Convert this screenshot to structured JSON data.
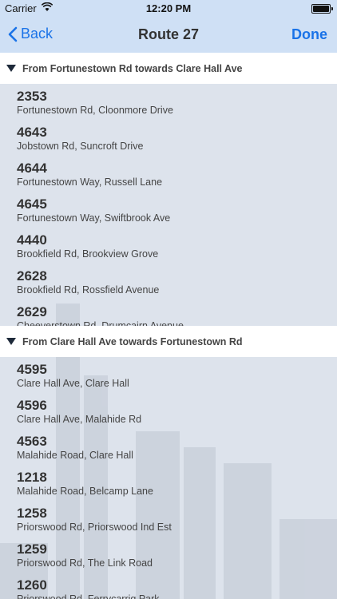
{
  "status_bar": {
    "carrier": "Carrier",
    "time": "12:20 PM"
  },
  "nav": {
    "back_label": "Back",
    "title": "Route 27",
    "done_label": "Done"
  },
  "sections": [
    {
      "header": "From Fortunestown Rd towards Clare Hall Ave",
      "stops": [
        {
          "number": "2353",
          "name": "Fortunestown Rd, Cloonmore Drive"
        },
        {
          "number": "4643",
          "name": "Jobstown Rd, Suncroft Drive"
        },
        {
          "number": "4644",
          "name": "Fortunestown Way, Russell Lane"
        },
        {
          "number": "4645",
          "name": "Fortunestown Way, Swiftbrook Ave"
        },
        {
          "number": "4440",
          "name": "Brookfield Rd, Brookview Grove"
        },
        {
          "number": "2628",
          "name": "Brookfield Rd, Rossfield Avenue"
        },
        {
          "number": "2629",
          "name": "Cheeverstown Rd, Drumcairn Avenue"
        }
      ]
    },
    {
      "header": "From Clare Hall Ave towards Fortunestown Rd",
      "stops": [
        {
          "number": "4595",
          "name": "Clare Hall Ave, Clare Hall"
        },
        {
          "number": "4596",
          "name": "Clare Hall Ave, Malahide Rd"
        },
        {
          "number": "4563",
          "name": "Malahide Road, Clare Hall"
        },
        {
          "number": "1218",
          "name": "Malahide Road, Belcamp Lane"
        },
        {
          "number": "1258",
          "name": "Priorswood Rd, Priorswood Ind Est"
        },
        {
          "number": "1259",
          "name": "Priorswood Rd, The Link Road"
        },
        {
          "number": "1260",
          "name": "Priorswood Rd, Ferrycarrig Park"
        }
      ]
    }
  ],
  "colors": {
    "accent": "#1a73e8",
    "bar": "#cfe0f5",
    "background": "#dde3ec"
  }
}
